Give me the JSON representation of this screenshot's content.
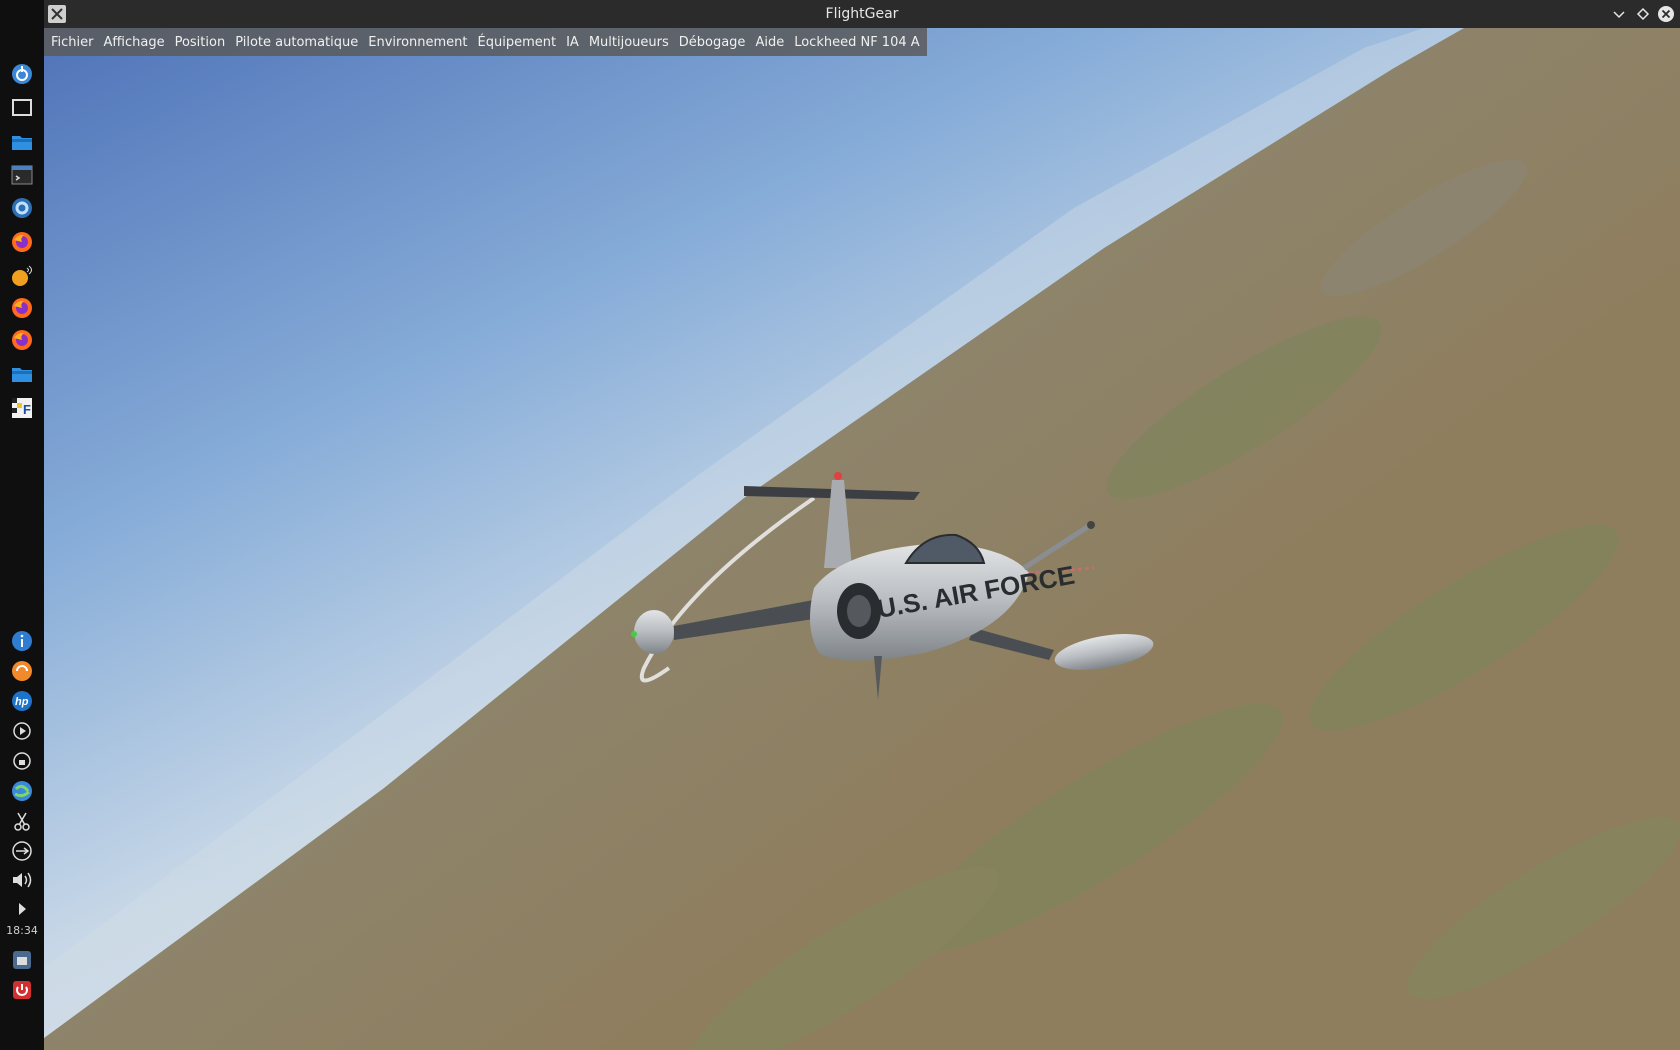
{
  "window": {
    "title": "FlightGear"
  },
  "menubar": {
    "items": [
      "Fichier",
      "Affichage",
      "Position",
      "Pilote automatique",
      "Environnement",
      "Équipement",
      "IA",
      "Multijoueurs",
      "Débogage",
      "Aide",
      "Lockheed NF 104 A"
    ]
  },
  "aircraft": {
    "fuselage_text": "U.S. AIR FORCE"
  },
  "panel": {
    "top_icons": [
      "plasma-icon",
      "desktop-icon",
      "folder-icon",
      "terminal-icon",
      "settings-icon",
      "firefox-icon",
      "vlc-icon",
      "firefox-icon",
      "firefox-icon",
      "files-icon",
      "flightgear-icon"
    ],
    "bottom_icons": [
      "info-icon",
      "update-icon",
      "hp-icon",
      "media-icon",
      "vpn-icon",
      "network-icon",
      "scissors-icon",
      "usb-icon",
      "volume-icon",
      "expand-icon"
    ],
    "clock": "18:34"
  },
  "colors": {
    "sky_top": "#5a80bf",
    "horizon": "#c8d8e6",
    "terrain": "#8f8468",
    "titlebar": "#2b2b2b",
    "panel": "#0f0f0f"
  }
}
